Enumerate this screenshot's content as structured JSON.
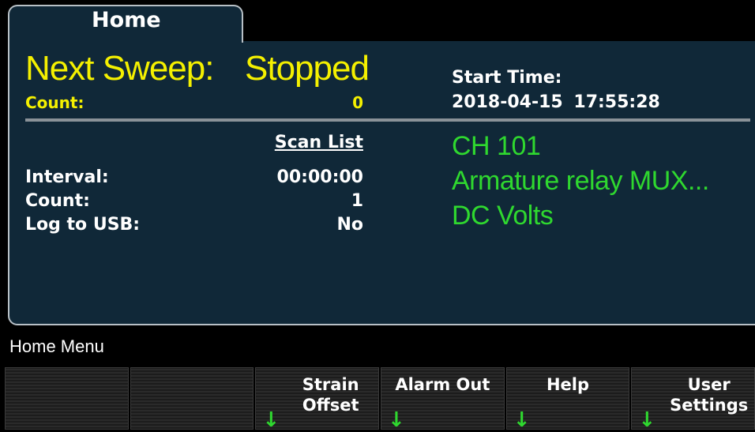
{
  "tab": {
    "label": "Home"
  },
  "sweep": {
    "label": "Next Sweep:",
    "status": "Stopped",
    "count_label": "Count:",
    "count_value": "0"
  },
  "start_time": {
    "label": "Start Time:",
    "value": "2018-04-15 17:55:28"
  },
  "scan_list": {
    "title": "Scan List",
    "rows": [
      {
        "label": "Interval:",
        "value": "00:00:00"
      },
      {
        "label": "Count:",
        "value": "1"
      },
      {
        "label": "Log to USB:",
        "value": "No"
      }
    ]
  },
  "channel": {
    "id": "CH 101",
    "module": "Armature relay MUX...",
    "function": "DC Volts"
  },
  "menu": {
    "label": "Home Menu"
  },
  "softkeys": [
    {
      "label": "",
      "submenu": false
    },
    {
      "label": "",
      "submenu": false
    },
    {
      "label": "Strain Offset",
      "submenu": true
    },
    {
      "label": "Alarm Out",
      "submenu": true
    },
    {
      "label": "Help",
      "submenu": true
    },
    {
      "label": "User Settings",
      "submenu": true
    }
  ],
  "colors": {
    "panel": "#102838",
    "yellow": "#f4f000",
    "green": "#2fd82f",
    "white": "#ffffff"
  },
  "icons": {
    "submenu_arrow": "down-arrow-icon"
  }
}
